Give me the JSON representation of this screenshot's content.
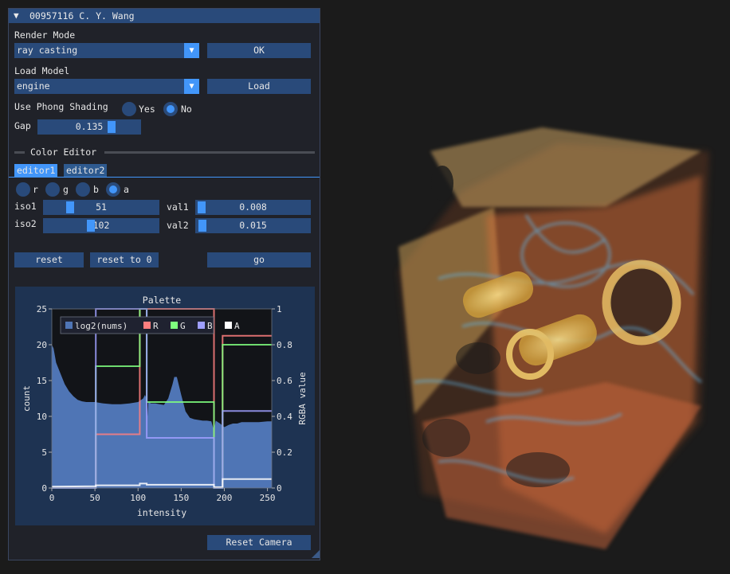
{
  "window": {
    "title": "00957116 C. Y. Wang"
  },
  "render_mode": {
    "label": "Render Mode",
    "value": "ray casting",
    "ok_label": "OK"
  },
  "load_model": {
    "label": "Load Model",
    "value": "engine",
    "load_label": "Load"
  },
  "phong": {
    "label": "Use Phong Shading",
    "yes_label": "Yes",
    "no_label": "No",
    "selected": "No"
  },
  "gap": {
    "label": "Gap",
    "value": "0.135",
    "fraction": 0.72
  },
  "color_editor": {
    "header": "Color Editor",
    "tabs": [
      "editor1",
      "editor2"
    ],
    "active_tab": "editor1",
    "channels": [
      "r",
      "g",
      "b",
      "a"
    ],
    "selected_channel": "a",
    "iso1": {
      "label": "iso1",
      "value": "51",
      "fraction": 0.2
    },
    "iso2": {
      "label": "iso2",
      "value": "102",
      "fraction": 0.4
    },
    "val1": {
      "label": "val1",
      "value": "0.008",
      "fraction": 0.008
    },
    "val2": {
      "label": "val2",
      "value": "0.015",
      "fraction": 0.015
    },
    "reset_label": "reset",
    "reset0_label": "reset to 0",
    "go_label": "go"
  },
  "reset_camera_label": "Reset Camera",
  "chart_data": {
    "type": "area",
    "title": "Palette",
    "xlabel": "intensity",
    "ylabel": "count",
    "y2label": "RGBA value",
    "xlim": [
      0,
      255
    ],
    "ylim": [
      0,
      25
    ],
    "y2lim": [
      0,
      1
    ],
    "xticks": [
      "0",
      "50",
      "100",
      "150",
      "200",
      "250"
    ],
    "yticks": [
      "0",
      "5",
      "10",
      "15",
      "20",
      "25"
    ],
    "y2ticks": [
      "0",
      "0.2",
      "0.4",
      "0.6",
      "0.8",
      "1"
    ],
    "legend": [
      "log2(nums)",
      "R",
      "G",
      "B",
      "A"
    ],
    "legend_position": "top-left",
    "series": [
      {
        "name": "log2(nums)",
        "axis": "left",
        "color": "#4f75b5",
        "x": [
          0,
          2,
          5,
          10,
          15,
          20,
          25,
          30,
          35,
          40,
          45,
          50,
          60,
          70,
          80,
          90,
          100,
          106,
          108,
          110,
          111,
          112,
          115,
          120,
          125,
          130,
          135,
          140,
          142,
          145,
          150,
          155,
          160,
          165,
          170,
          175,
          180,
          185,
          188,
          190,
          195,
          200,
          205,
          210,
          215,
          220,
          230,
          240,
          250,
          255
        ],
        "y": [
          20,
          19.5,
          17.5,
          16,
          14.5,
          13.5,
          12.8,
          12.3,
          12.1,
          12,
          12,
          12,
          11.8,
          11.7,
          11.7,
          11.8,
          12,
          12.5,
          13,
          12.4,
          10,
          12,
          11.8,
          11.8,
          11.7,
          11.6,
          12.5,
          14.5,
          15.5,
          15.5,
          13,
          10.7,
          9.8,
          9.6,
          9.5,
          9.4,
          9.4,
          9.3,
          8,
          9.4,
          9,
          8.5,
          8.8,
          9,
          9,
          9.2,
          9.2,
          9.2,
          9.3,
          9.3
        ]
      },
      {
        "name": "R",
        "axis": "right",
        "color": "#ff7f7f",
        "x": [
          0,
          51,
          51,
          102,
          102,
          110,
          110,
          188,
          188,
          198,
          198,
          255
        ],
        "y": [
          0,
          0,
          0.3,
          0.3,
          1,
          1,
          1,
          1,
          0,
          0,
          0.85,
          0.85
        ]
      },
      {
        "name": "G",
        "axis": "right",
        "color": "#7fff7f",
        "x": [
          0,
          51,
          51,
          102,
          102,
          110,
          110,
          188,
          188,
          198,
          198,
          255
        ],
        "y": [
          0,
          0,
          0.68,
          0.68,
          1,
          1,
          0.48,
          0.48,
          0,
          0,
          0.8,
          0.8
        ]
      },
      {
        "name": "B",
        "axis": "right",
        "color": "#9f9fff",
        "x": [
          0,
          51,
          51,
          102,
          102,
          110,
          110,
          188,
          188,
          198,
          198,
          255
        ],
        "y": [
          0,
          0,
          1,
          1,
          1,
          1,
          0.28,
          0.28,
          0,
          0,
          0.43,
          0.43
        ]
      },
      {
        "name": "A",
        "axis": "right",
        "color": "#ffffff",
        "x": [
          0,
          51,
          51,
          102,
          102,
          110,
          110,
          188,
          188,
          198,
          198,
          255
        ],
        "y": [
          0.008,
          0.01,
          0.015,
          0.015,
          0.025,
          0.025,
          0.018,
          0.018,
          0.005,
          0.005,
          0.05,
          0.05
        ]
      }
    ]
  },
  "colors": {
    "accent": "#4296fa",
    "frame": "#294a7a",
    "title_bar": "#294a7a",
    "window_bg": "#202229"
  }
}
